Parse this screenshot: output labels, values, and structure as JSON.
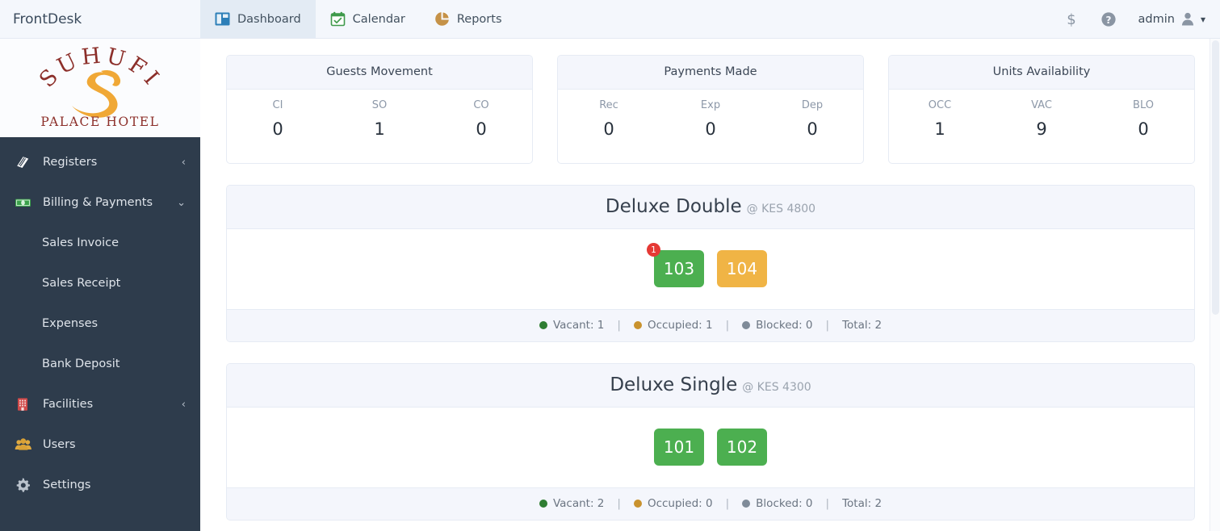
{
  "app": {
    "brand": "FrontDesk"
  },
  "topnav": {
    "tabs": [
      {
        "label": "Dashboard",
        "icon": "dashboard-layout-icon",
        "active": true
      },
      {
        "label": "Calendar",
        "icon": "calendar-check-icon",
        "active": false
      },
      {
        "label": "Reports",
        "icon": "pie-chart-icon",
        "active": false
      }
    ],
    "currency_icon": "dollar-sign-icon",
    "help_icon": "help-circle-icon",
    "user": "admin",
    "user_icon": "user-avatar-icon",
    "user_caret": "▾"
  },
  "sidebar": {
    "logo": {
      "arc_text": "SUHUFI",
      "monogram": "S",
      "sub_text": "PALACE HOTEL",
      "arc_color": "#8c2f2a",
      "monogram_color": "#f0a836"
    },
    "items": [
      {
        "label": "Registers",
        "icon": "book-icon",
        "caret": "‹",
        "type": "parent"
      },
      {
        "label": "Billing & Payments",
        "icon": "banknote-icon",
        "caret": "⌄",
        "type": "parent"
      },
      {
        "label": "Sales Invoice",
        "type": "child"
      },
      {
        "label": "Sales Receipt",
        "type": "child"
      },
      {
        "label": "Expenses",
        "type": "child"
      },
      {
        "label": "Bank Deposit",
        "type": "child"
      },
      {
        "label": "Facilities",
        "icon": "building-icon",
        "caret": "‹",
        "type": "parent"
      },
      {
        "label": "Users",
        "icon": "users-icon",
        "type": "parent"
      },
      {
        "label": "Settings",
        "icon": "gear-icon",
        "type": "parent"
      }
    ]
  },
  "stats": [
    {
      "title": "Guests Movement",
      "cols": [
        {
          "key": "CI",
          "value": "0"
        },
        {
          "key": "SO",
          "value": "1"
        },
        {
          "key": "CO",
          "value": "0"
        }
      ]
    },
    {
      "title": "Payments Made",
      "cols": [
        {
          "key": "Rec",
          "value": "0"
        },
        {
          "key": "Exp",
          "value": "0"
        },
        {
          "key": "Dep",
          "value": "0"
        }
      ]
    },
    {
      "title": "Units Availability",
      "cols": [
        {
          "key": "OCC",
          "value": "1"
        },
        {
          "key": "VAC",
          "value": "9"
        },
        {
          "key": "BLO",
          "value": "0"
        }
      ]
    }
  ],
  "room_groups": [
    {
      "title": "Deluxe Double",
      "rate": "@ KES 4800",
      "units": [
        {
          "number": "103",
          "status": "vacant",
          "badge": "1"
        },
        {
          "number": "104",
          "status": "occupied",
          "badge": null
        }
      ],
      "summary": {
        "vacant_label": "Vacant: 1",
        "occupied_label": "Occupied: 1",
        "blocked_label": "Blocked: 0",
        "total_label": "Total: 2",
        "divider": "|"
      }
    },
    {
      "title": "Deluxe Single",
      "rate": "@ KES 4300",
      "units": [
        {
          "number": "101",
          "status": "vacant",
          "badge": null
        },
        {
          "number": "102",
          "status": "vacant",
          "badge": null
        }
      ],
      "summary": {
        "vacant_label": "Vacant: 2",
        "occupied_label": "Occupied: 0",
        "blocked_label": "Blocked: 0",
        "total_label": "Total: 2",
        "divider": "|"
      }
    }
  ],
  "colors": {
    "sidebar_bg": "#2e3c4c",
    "topbar_bg": "#f4f7fc",
    "vacant": "#4caf50",
    "occupied": "#f0b445",
    "blocked": "#8896a6",
    "badge": "#e53935",
    "card_head": "#f4f6fc"
  }
}
